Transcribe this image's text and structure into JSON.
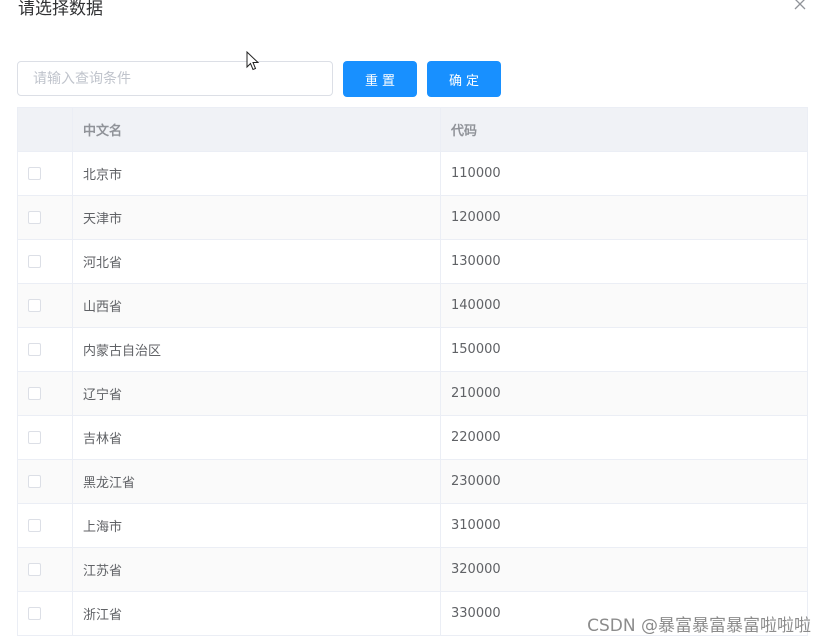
{
  "dialog": {
    "title": "请选择数据"
  },
  "search": {
    "placeholder": "请输入查询条件",
    "value": ""
  },
  "buttons": {
    "reset": "重置",
    "confirm": "确定"
  },
  "table": {
    "columns": [
      "中文名",
      "代码"
    ],
    "rows": [
      {
        "name": "北京市",
        "code": "110000"
      },
      {
        "name": "天津市",
        "code": "120000"
      },
      {
        "name": "河北省",
        "code": "130000"
      },
      {
        "name": "山西省",
        "code": "140000"
      },
      {
        "name": "内蒙古自治区",
        "code": "150000"
      },
      {
        "name": "辽宁省",
        "code": "210000"
      },
      {
        "name": "吉林省",
        "code": "220000"
      },
      {
        "name": "黑龙江省",
        "code": "230000"
      },
      {
        "name": "上海市",
        "code": "310000"
      },
      {
        "name": "江苏省",
        "code": "320000"
      },
      {
        "name": "浙江省",
        "code": "330000"
      }
    ]
  },
  "watermark": "CSDN @暴富暴富暴富啦啦啦",
  "colors": {
    "primary": "#1890ff",
    "header_bg": "#f0f2f6",
    "stripe_bg": "#fafafa",
    "border": "#ebeef5"
  }
}
